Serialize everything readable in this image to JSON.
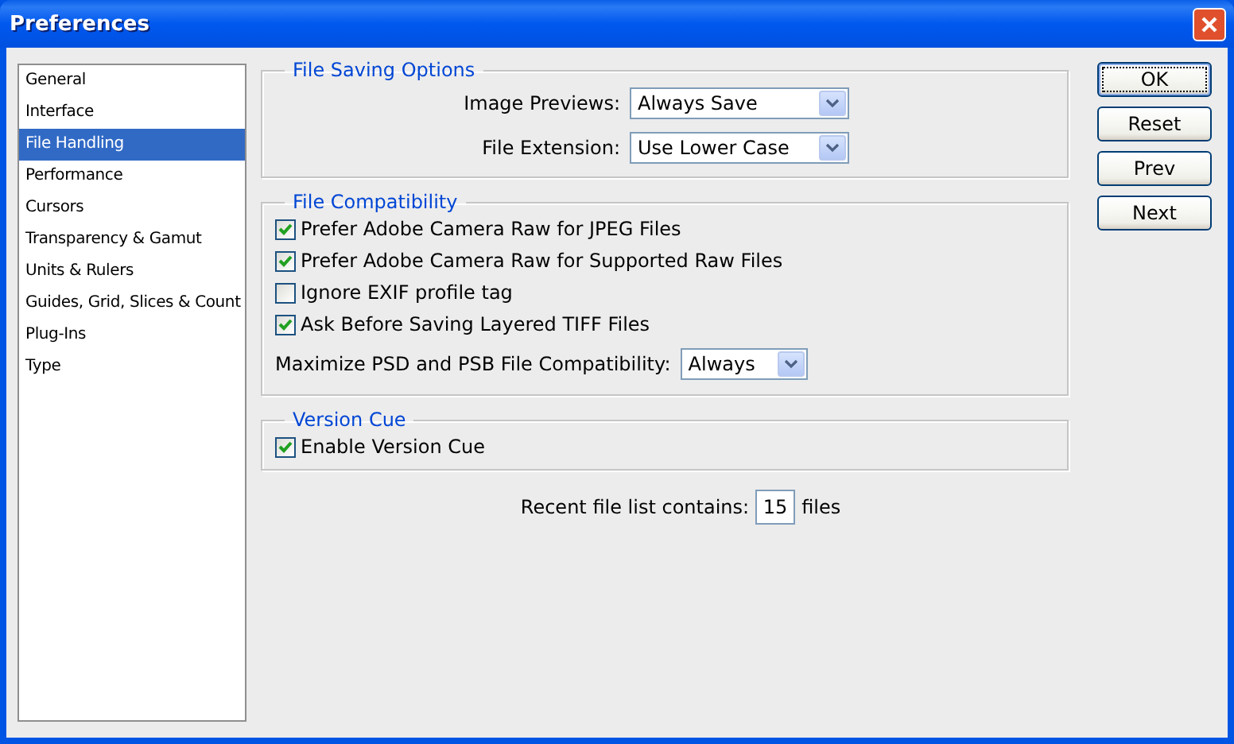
{
  "window": {
    "title": "Preferences"
  },
  "sidebar": {
    "items": [
      {
        "label": "General",
        "selected": false
      },
      {
        "label": "Interface",
        "selected": false
      },
      {
        "label": "File Handling",
        "selected": true
      },
      {
        "label": "Performance",
        "selected": false
      },
      {
        "label": "Cursors",
        "selected": false
      },
      {
        "label": "Transparency & Gamut",
        "selected": false
      },
      {
        "label": "Units & Rulers",
        "selected": false
      },
      {
        "label": "Guides, Grid, Slices & Count",
        "selected": false
      },
      {
        "label": "Plug-Ins",
        "selected": false
      },
      {
        "label": "Type",
        "selected": false
      }
    ]
  },
  "groups": [
    {
      "kind": "form",
      "title": "File Saving Options",
      "rows": [
        {
          "kind": "select",
          "label": "Image Previews:",
          "value": "Always Save"
        },
        {
          "kind": "select",
          "label": "File Extension:",
          "value": "Use Lower Case"
        }
      ]
    },
    {
      "kind": "options",
      "title": "File Compatibility",
      "rows": [
        {
          "kind": "checkbox",
          "label": "Prefer Adobe Camera Raw for JPEG Files",
          "checked": true
        },
        {
          "kind": "checkbox",
          "label": "Prefer Adobe Camera Raw for Supported Raw Files",
          "checked": true
        },
        {
          "kind": "checkbox",
          "label": "Ignore EXIF profile tag",
          "checked": false
        },
        {
          "kind": "checkbox",
          "label": "Ask Before Saving Layered TIFF Files",
          "checked": true
        },
        {
          "kind": "select",
          "label": "Maximize PSD and PSB File Compatibility:",
          "value": "Always"
        }
      ]
    },
    {
      "kind": "options",
      "title": "Version Cue",
      "rows": [
        {
          "kind": "checkbox",
          "label": "Enable Version Cue",
          "checked": true
        }
      ]
    }
  ],
  "recent": {
    "label": "Recent file list contains:",
    "value": "15",
    "suffix": "files"
  },
  "buttons": [
    {
      "label": "OK",
      "default": true
    },
    {
      "label": "Reset",
      "default": false
    },
    {
      "label": "Prev",
      "default": false
    },
    {
      "label": "Next",
      "default": false
    }
  ]
}
